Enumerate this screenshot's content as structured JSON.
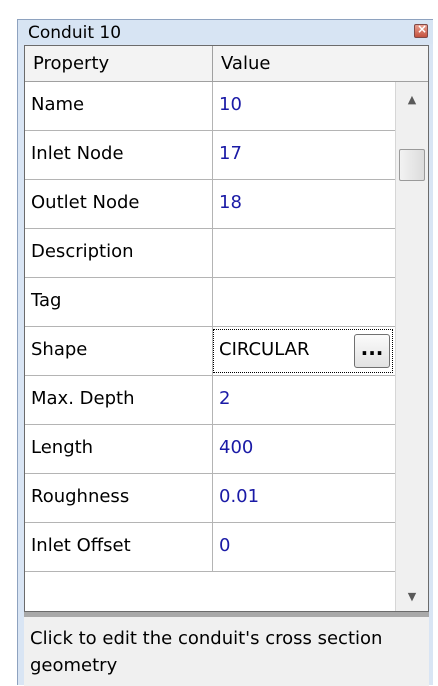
{
  "window": {
    "title": "Conduit 10",
    "close_glyph": "×"
  },
  "grid": {
    "headers": {
      "property": "Property",
      "value": "Value"
    },
    "rows": [
      {
        "property": "Name",
        "value": "10"
      },
      {
        "property": "Inlet Node",
        "value": "17"
      },
      {
        "property": "Outlet Node",
        "value": "18"
      },
      {
        "property": "Description",
        "value": ""
      },
      {
        "property": "Tag",
        "value": ""
      },
      {
        "property": "Shape",
        "value": "CIRCULAR",
        "editor_button": "..."
      },
      {
        "property": "Max. Depth",
        "value": "2"
      },
      {
        "property": "Length",
        "value": "400"
      },
      {
        "property": "Roughness",
        "value": "0.01"
      },
      {
        "property": "Inlet Offset",
        "value": "0"
      }
    ]
  },
  "scrollbar": {
    "up_glyph": "▲",
    "down_glyph": "▼"
  },
  "description": "Click to edit the conduit's cross section geometry",
  "colors": {
    "value_text": "#1a1aa6",
    "panel_background": "#d9e5f4"
  }
}
